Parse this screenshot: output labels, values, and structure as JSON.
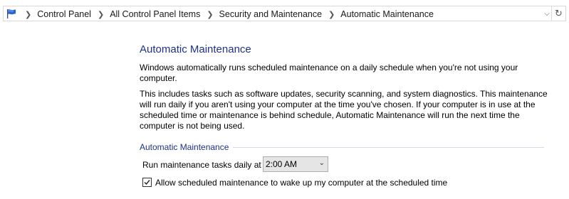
{
  "address_bar": {
    "icon": "control-panel-flag-icon",
    "breadcrumbs": [
      "Control Panel",
      "All Control Panel Items",
      "Security and Maintenance",
      "Automatic Maintenance"
    ],
    "dropdown_icon": "chevron-down-icon",
    "refresh_icon": "refresh-icon"
  },
  "main": {
    "title": "Automatic Maintenance",
    "paragraph1": "Windows automatically runs scheduled maintenance on a daily schedule when you're not using your computer.",
    "paragraph2": "This includes tasks such as software updates, security scanning, and system diagnostics. This maintenance will run daily if you aren't using your computer at the time you've chosen. If your computer is in use at the scheduled time or maintenance is behind schedule, Automatic Maintenance will run the next time the computer is not being used.",
    "group_heading": "Automatic Maintenance",
    "run_label": "Run maintenance tasks daily at",
    "time_select": {
      "value": "2:00 AM"
    },
    "wake_checkbox": {
      "checked": true,
      "label": "Allow scheduled maintenance to wake up my computer at the scheduled time"
    }
  },
  "colors": {
    "heading": "#1e3287",
    "border": "#d9d9d9"
  }
}
